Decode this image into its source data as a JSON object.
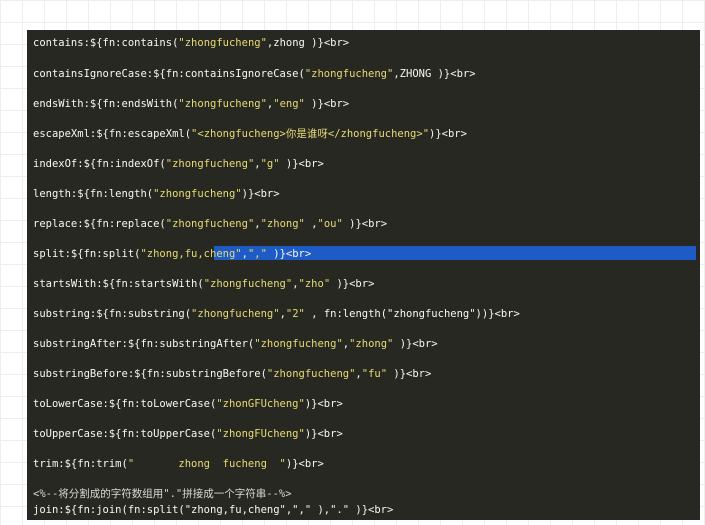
{
  "editor": {
    "lines": [
      {
        "key": "contains",
        "fn": "contains",
        "args": [
          "\"zhongfucheng\"",
          "zhong"
        ],
        "tail": " )}<br>"
      },
      {
        "key": "containsIgnoreCase",
        "fn": "containsIgnoreCase",
        "args": [
          "\"zhongfucheng\"",
          "ZHONG"
        ],
        "tail": " )}<br>"
      },
      {
        "key": "endsWith",
        "fn": "endsWith",
        "args": [
          "\"zhongfucheng\"",
          "\"eng\""
        ],
        "tail": " )}<br>"
      },
      {
        "key": "escapeXml",
        "fn": "escapeXml",
        "args": [
          "\"<zhongfucheng>你是谁呀</zhongfucheng>\""
        ],
        "tail": ")}<br>"
      },
      {
        "key": "indexOf",
        "fn": "indexOf",
        "args": [
          "\"zhongfucheng\"",
          "\"g\""
        ],
        "tail": " )}<br>"
      },
      {
        "key": "length",
        "fn": "length",
        "args": [
          "\"zhongfucheng\""
        ],
        "tail": ")}<br>"
      },
      {
        "key": "replace",
        "fn": "replace",
        "args": [
          "\"zhongfucheng\"",
          "\"zhong\" ",
          "\"ou\""
        ],
        "tail": " )}<br>"
      },
      {
        "key": "split",
        "fn": "split",
        "args": [
          "\"zhong,fu,cheng\"",
          "\",\""
        ],
        "tail": " )}<br>"
      },
      {
        "key": "startsWith",
        "fn": "startsWith",
        "args": [
          "\"zhongfucheng\"",
          "\"zho\""
        ],
        "tail": " )}<br>"
      },
      {
        "key": "substring",
        "fn": "substring",
        "args": [
          "\"zhongfucheng\"",
          "\"2\" ",
          " fn:length(\"zhongfucheng\")"
        ],
        "tail": ")}<br>"
      },
      {
        "key": "substringAfter",
        "fn": "substringAfter",
        "args": [
          "\"zhongfucheng\"",
          "\"zhong\""
        ],
        "tail": " )}<br>"
      },
      {
        "key": "substringBefore",
        "fn": "substringBefore",
        "args": [
          "\"zhongfucheng\"",
          "\"fu\""
        ],
        "tail": " )}<br>"
      },
      {
        "key": "toLowerCase",
        "fn": "toLowerCase",
        "args": [
          "\"zhonGFUcheng\""
        ],
        "tail": ")}<br>"
      },
      {
        "key": "toUpperCase",
        "fn": "toUpperCase",
        "args": [
          "\"zhongFUcheng\""
        ],
        "tail": ")}<br>"
      },
      {
        "key": "trim",
        "fn": "trim",
        "args": [
          "\"       zhong  fucheng  \""
        ],
        "tail": ")}<br>"
      }
    ],
    "comment": "<%--将分割成的字符数组用\".\"拼接成一个字符串--%>",
    "join_line": "join:${fn:join(fn:split(\"zhong,fu,cheng\",\",\" ),\".\" )}<br>"
  }
}
